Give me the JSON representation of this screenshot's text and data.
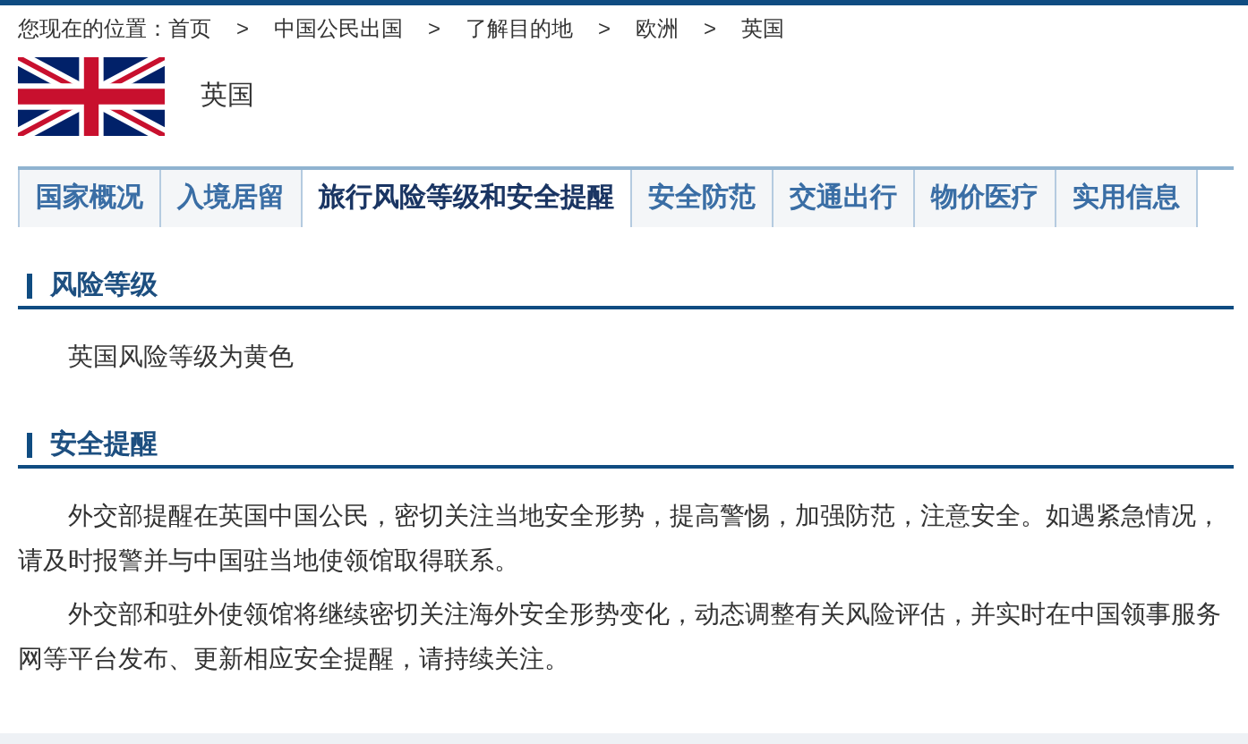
{
  "breadcrumb": {
    "prefix": "您现在的位置：",
    "items": [
      "首页",
      "中国公民出国",
      "了解目的地",
      "欧洲",
      "英国"
    ],
    "separators": [
      ">",
      ">",
      ">",
      ">"
    ]
  },
  "country": {
    "name": "英国"
  },
  "tabs": [
    {
      "label": "国家概况",
      "selected": false
    },
    {
      "label": "入境居留",
      "selected": false
    },
    {
      "label": "旅行风险等级和安全提醒",
      "selected": true
    },
    {
      "label": "安全防范",
      "selected": false
    },
    {
      "label": "交通出行",
      "selected": false
    },
    {
      "label": "物价医疗",
      "selected": false
    },
    {
      "label": "实用信息",
      "selected": false
    }
  ],
  "sections": [
    {
      "heading": "风险等级",
      "paragraphs": [
        "英国风险等级为黄色"
      ]
    },
    {
      "heading": "安全提醒",
      "paragraphs": [
        "外交部提醒在英国中国公民，密切关注当地安全形势，提高警惕，加强防范，注意安全。如遇紧急情况，请及时报警并与中国驻当地使领馆取得联系。",
        "外交部和驻外使领馆将继续密切关注海外安全形势变化，动态调整有关风险评估，并实时在中国领事服务网等平台发布、更新相应安全提醒，请持续关注。"
      ]
    }
  ]
}
